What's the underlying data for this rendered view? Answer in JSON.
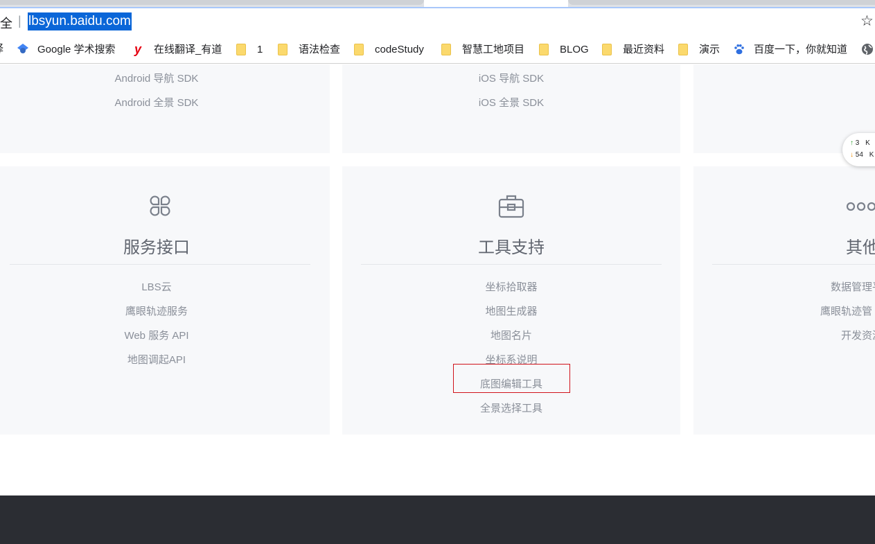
{
  "browser": {
    "secure_label": "全",
    "separator": "|",
    "url": "lbsyun.baidu.com",
    "bookmark_icon": "star-icon"
  },
  "bookmarks": {
    "cut_item": "译",
    "items": [
      {
        "label": "Google 学术搜索",
        "icon": "google-scholar-icon"
      },
      {
        "label": "在线翻译_有道",
        "icon": "youdao-icon"
      },
      {
        "label": "1",
        "icon": "folder-icon"
      },
      {
        "label": "语法检查",
        "icon": "folder-icon"
      },
      {
        "label": "codeStudy",
        "icon": "folder-icon"
      },
      {
        "label": "智慧工地项目",
        "icon": "folder-icon"
      },
      {
        "label": "BLOG",
        "icon": "folder-icon"
      },
      {
        "label": "最近资料",
        "icon": "folder-icon"
      },
      {
        "label": "演示",
        "icon": "folder-icon"
      },
      {
        "label": "百度一下，你就知道",
        "icon": "baidu-paw-icon"
      }
    ],
    "overflow_icon": "globe-icon"
  },
  "top_cards": {
    "android": {
      "links": [
        "Android 导航 SDK",
        "Android 全景 SDK"
      ]
    },
    "ios": {
      "links": [
        "iOS 导航 SDK",
        "iOS 全景 SDK"
      ]
    }
  },
  "cards": {
    "service": {
      "icon": "four-leaf-grid-icon",
      "title": "服务接口",
      "links": [
        "LBS云",
        "鹰眼轨迹服务",
        "Web 服务 API",
        "地图调起API"
      ]
    },
    "tools": {
      "icon": "toolbox-icon",
      "title": "工具支持",
      "links": [
        "坐标拾取器",
        "地图生成器",
        "地图名片",
        "坐标系说明",
        "底图编辑工具",
        "全景选择工具"
      ],
      "highlighted": "底图编辑工具"
    },
    "other": {
      "icon": "more-dots-icon",
      "title": "其他",
      "links": [
        "数据管理平",
        "鹰眼轨迹管",
        "开发资源"
      ]
    }
  },
  "speed_widget": {
    "up_value": "3",
    "up_unit": "K",
    "down_value": "54",
    "down_unit": "K",
    "up_color": "#2ca02c",
    "down_color": "#f08c00"
  },
  "colors": {
    "url_highlight": "#0a66d8",
    "card_bg": "#f7f8fa",
    "highlight_border": "#d0121a",
    "footer_bg": "#2b2d33"
  }
}
